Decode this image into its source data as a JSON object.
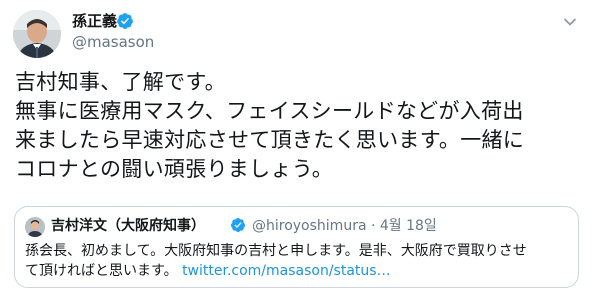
{
  "author": {
    "name": "孫正義",
    "handle": "@masason"
  },
  "tweet": {
    "lines": [
      "吉村知事、了解です。",
      "無事に医療用マスク、フェイスシールドなどが入荷出",
      "来ましたら早速対応させて頂きたく思います。一緒に",
      "コロナとの闘い頑張りましょう。"
    ]
  },
  "quoted_tweet": {
    "name": "吉村洋文（大阪府知事）",
    "handle_date": "@hiroyoshimura · 4월 18일",
    "line1": "孫会長、初めまして。大阪府知事の吉村と申します。是非、大阪府で買取りさせ",
    "line2_text": "て頂ければと思います。",
    "line2_link": "twitter.com/masason/status…"
  },
  "colors": {
    "verified": "#1da1f2",
    "secondary_text": "#657786",
    "link": "#1b95e0",
    "border": "#ccd6dd"
  },
  "icons": {
    "verified": "verified-badge-icon",
    "caret": "chevron-down-icon"
  }
}
